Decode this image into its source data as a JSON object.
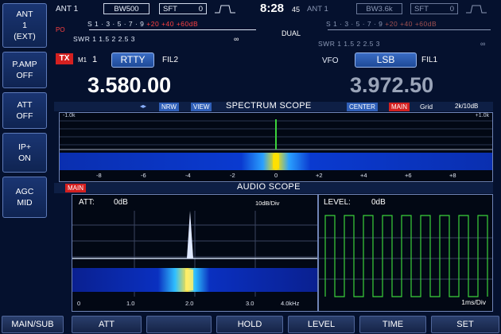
{
  "sidebar": {
    "items": [
      {
        "line1": "ANT",
        "line2": "1",
        "line3": "(EXT)"
      },
      {
        "line1": "P.AMP",
        "line2": "OFF",
        "line3": ""
      },
      {
        "line1": "ATT",
        "line2": "OFF",
        "line3": ""
      },
      {
        "line1": "IP+",
        "line2": "ON",
        "line3": ""
      },
      {
        "line1": "AGC",
        "line2": "MID",
        "line3": ""
      }
    ]
  },
  "top": {
    "ant_main": "ANT 1",
    "bw_main": "BW500",
    "sft_main_label": "SFT",
    "sft_main_value": "0",
    "time": "8:28",
    "time_sec": "45",
    "ant_sub": "ANT 1",
    "bw_sub": "BW3.6k",
    "sft_sub_label": "SFT",
    "sft_sub_value": "0"
  },
  "meter_main": {
    "s_label": "S",
    "s_scale": "1 · 3 · 5 · 7 · 9",
    "s_plus": "+20 +40 +60dB",
    "po_label": "PO",
    "swr_label": "SWR",
    "swr_scale": "1    1.5   2  2.5  3",
    "swr_inf": "∞"
  },
  "meter_sub": {
    "dual": "DUAL",
    "s_label": "S",
    "s_scale": "1 · 3 · 5 · 7 · 9",
    "s_plus": "+20 +40 +60dB",
    "swr_label": "SWR",
    "swr_scale": "1    1.5   2  2.5  3",
    "swr_inf": "∞"
  },
  "vfo_main": {
    "tx": "TX",
    "mem": "M1",
    "num": "1",
    "mode": "RTTY",
    "fil": "FIL2",
    "freq": "3.580.00"
  },
  "vfo_sub": {
    "vfo": "VFO",
    "mode": "LSB",
    "fil": "FIL1",
    "freq": "3.972.50"
  },
  "spectrum": {
    "title": "SPECTRUM SCOPE",
    "nrw": "NRW",
    "view": "VIEW",
    "center": "CENTER",
    "main": "MAIN",
    "grid": "Grid",
    "span": "2k/10dB",
    "left_mark": "-1.0k",
    "right_mark": "+1.0k",
    "ticks": [
      "-8",
      "-6",
      "-4",
      "-2",
      "0",
      "+2",
      "+4",
      "+6",
      "+8"
    ]
  },
  "audio": {
    "main": "MAIN",
    "title": "AUDIO SCOPE",
    "att_label": "ATT:",
    "att_value": "0dB",
    "scale": "10dB/Div",
    "level_label": "LEVEL:",
    "level_value": "0dB",
    "fft_ticks": [
      "0",
      "1.0",
      "2.0",
      "3.0",
      "4.0kHz"
    ],
    "osc_scale": "1ms/Div"
  },
  "softkeys": [
    "MAIN/SUB",
    "ATT",
    "",
    "HOLD",
    "LEVEL",
    "TIME",
    "SET"
  ],
  "colors": {
    "background": "#05112e",
    "accent_blue": "#2f5fb8",
    "tx_red": "#d42020",
    "waveform_green": "#3bd23b"
  }
}
